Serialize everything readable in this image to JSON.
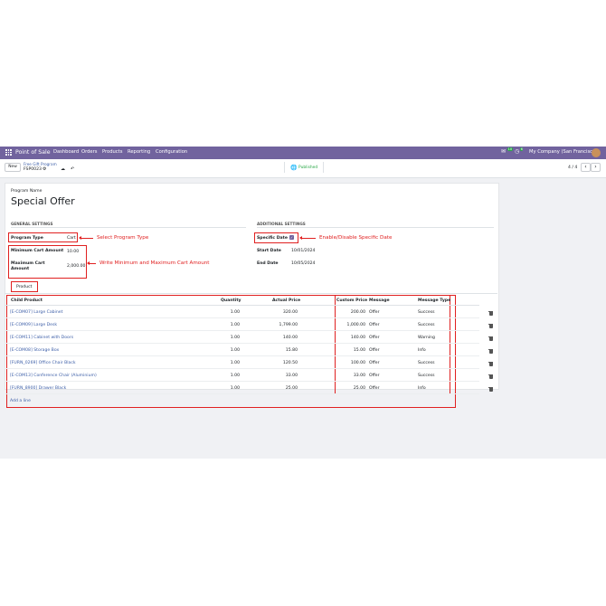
{
  "navbar": {
    "app_name": "Point of Sale",
    "menu": [
      "Dashboard",
      "Orders",
      "Products",
      "Reporting",
      "Configuration"
    ],
    "chat_badge": "10",
    "activity_badge": "6",
    "company": "My Company (San Francisco)"
  },
  "control": {
    "new_label": "New",
    "breadcrumb_parent": "Free Gift Program",
    "record_ref": "FSP0023",
    "status": "Published",
    "pager": "4 / 4"
  },
  "form": {
    "program_name_label": "Program Name",
    "program_name": "Special Offer",
    "general_settings": "GENERAL SETTINGS",
    "additional_settings": "ADDITIONAL SETTINGS",
    "program_type_label": "Program Type",
    "program_type_value": "Cart",
    "min_cart_label": "Minimum Cart Amount",
    "min_cart_value": "10.00",
    "max_cart_label_1": "Maximum Cart",
    "max_cart_label_2": "Amount",
    "max_cart_value": "2,000.00",
    "specific_date_label": "Specific Date",
    "specific_date_checked": true,
    "start_date_label": "Start Date",
    "start_date_value": "10/01/2024",
    "end_date_label": "End Date",
    "end_date_value": "10/05/2024",
    "tab_product": "Product"
  },
  "annotations": {
    "select_program_type": "Select  Program Type",
    "min_max_amount": "Write Minimum and Maximum Cart Amount",
    "enable_specific_date": "Enable/Disable Specific Date"
  },
  "table": {
    "headers": {
      "child_product": "Child Product",
      "quantity": "Quantity",
      "actual_price": "Actual Price",
      "custom_price": "Custom Price",
      "message": "Message",
      "message_type": "Message Type"
    },
    "rows": [
      {
        "product": "[E-COM07] Large Cabinet",
        "qty": "1.00",
        "actual": "320.00",
        "custom": "200.00",
        "message": "Offer",
        "type": "Success"
      },
      {
        "product": "[E-COM09] Large Desk",
        "qty": "1.00",
        "actual": "1,799.00",
        "custom": "1,000.00",
        "message": "Offer",
        "type": "Success"
      },
      {
        "product": "[E-COM11] Cabinet with Doors",
        "qty": "1.00",
        "actual": "140.00",
        "custom": "140.00",
        "message": "Offer",
        "type": "Warning"
      },
      {
        "product": "[E-COM08] Storage Box",
        "qty": "1.00",
        "actual": "15.80",
        "custom": "15.00",
        "message": "Offer",
        "type": "Info"
      },
      {
        "product": "[FURN_0269] Office Chair Black",
        "qty": "1.00",
        "actual": "120.50",
        "custom": "100.00",
        "message": "Offer",
        "type": "Success"
      },
      {
        "product": "[E-COM13] Conference Chair (Aluminium)",
        "qty": "1.00",
        "actual": "33.00",
        "custom": "33.00",
        "message": "Offer",
        "type": "Success"
      },
      {
        "product": "[FURN_8900] Drawer Black",
        "qty": "1.00",
        "actual": "25.00",
        "custom": "25.00",
        "message": "Offer",
        "type": "Info"
      }
    ],
    "add_line": "Add a line"
  },
  "colors": {
    "navbar": "#71639e",
    "link": "#3d5fa8",
    "annotation": "#e02020",
    "published": "#28a745"
  }
}
